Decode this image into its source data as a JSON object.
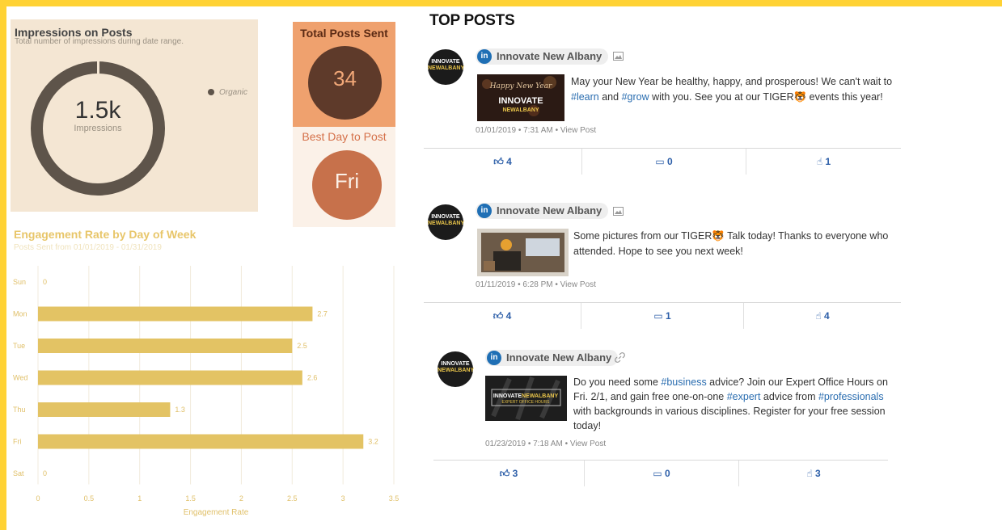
{
  "impressions": {
    "title": "Impressions on Posts",
    "subtitle": "Total number of impressions during date range.",
    "value": "1.5k",
    "value_label": "Impressions",
    "legend": "Organic",
    "color": "#5e544a"
  },
  "total_posts": {
    "title": "Total Posts Sent",
    "value": "34"
  },
  "best_day": {
    "title": "Best Day to Post",
    "value": "Fri"
  },
  "engagement": {
    "title": "Engagement Rate by Day of Week",
    "subtitle": "Posts Sent from 01/01/2019 - 01/31/2019"
  },
  "chart_data": {
    "type": "bar",
    "orientation": "horizontal",
    "categories": [
      "Sun",
      "Mon",
      "Tue",
      "Wed",
      "Thu",
      "Fri",
      "Sat"
    ],
    "values": [
      0,
      2.7,
      2.5,
      2.6,
      1.3,
      3.2,
      0
    ],
    "value_labels": [
      "0",
      "2.7",
      "2.5",
      "2.6",
      "1.3",
      "3.2",
      "0"
    ],
    "xlabel": "Engagement Rate",
    "xlim": [
      0,
      3.5
    ],
    "xticks": [
      "0",
      "0.5",
      "1",
      "1.5",
      "2",
      "2.5",
      "3",
      "3.5"
    ],
    "grid": true,
    "bar_color": "#e3c364"
  },
  "top_posts": {
    "title": "TOP POSTS",
    "posts": [
      {
        "author": "Innovate New Albany",
        "type_icon": "image-icon",
        "text_parts": [
          {
            "t": "May your New Year be healthy, happy, and prosperous! We can't wait to "
          },
          {
            "t": "#learn",
            "tag": true
          },
          {
            "t": " and "
          },
          {
            "t": "#grow",
            "tag": true
          },
          {
            "t": " with you. See you at our TIGER🐯  events this year!"
          }
        ],
        "meta": "01/01/2019 • 7:31 AM • View Post",
        "likes": "4",
        "comments": "0",
        "clicks": "1",
        "thumb_text": "Happy New Year INNOVATE NEW ALBANY"
      },
      {
        "author": "Innovate New Albany",
        "type_icon": "image-icon",
        "text_parts": [
          {
            "t": "Some pictures from our TIGER🐯 Talk today! Thanks to everyone who attended. Hope to see you next week!"
          }
        ],
        "meta": "01/11/2019 • 6:28 PM • View Post",
        "likes": "4",
        "comments": "1",
        "clicks": "4",
        "thumb_text": ""
      },
      {
        "author": "Innovate New Albany",
        "type_icon": "link-icon",
        "text_parts": [
          {
            "t": "Do you need some "
          },
          {
            "t": "#business",
            "tag": true
          },
          {
            "t": " advice? Join our Expert Office Hours on Fri. 2/1, and gain free one-on-one "
          },
          {
            "t": "#expert",
            "tag": true
          },
          {
            "t": " advice from "
          },
          {
            "t": "#professionals",
            "tag": true
          },
          {
            "t": " with backgrounds in various disciplines. Register for your free session today!"
          }
        ],
        "meta": "01/23/2019 • 7:18 AM • View Post",
        "likes": "3",
        "comments": "0",
        "clicks": "3",
        "thumb_text": "INNOVATE NEW ALBANY EXPERT OFFICE HOURS"
      }
    ]
  },
  "avatar": {
    "line1": "INNOVATE",
    "line2": "NEWALBANY"
  }
}
